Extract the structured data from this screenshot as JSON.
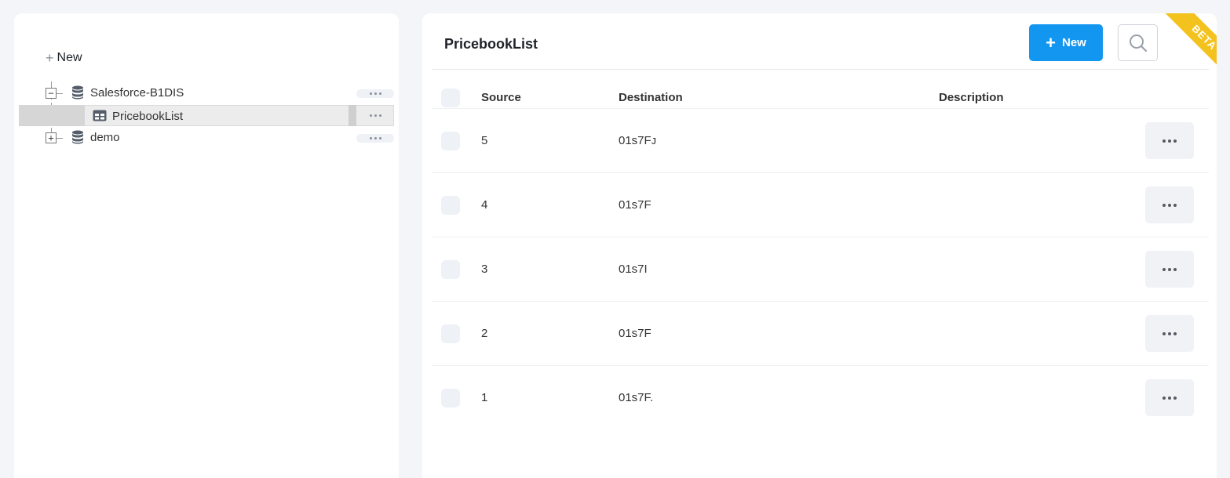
{
  "tree": {
    "new_label": "New",
    "items": [
      {
        "label": "Salesforce-B1DIS",
        "type": "database",
        "expander": "−"
      },
      {
        "label": "PricebookList",
        "type": "table"
      },
      {
        "label": "demo",
        "type": "database",
        "expander": "+"
      }
    ]
  },
  "main": {
    "title": "PricebookList",
    "new_button": "New",
    "beta_label": "BETA",
    "columns": {
      "source": "Source",
      "destination": "Destination",
      "description": "Description"
    },
    "rows": [
      {
        "source": "5",
        "destination": "01s7Fᴊ",
        "description": ""
      },
      {
        "source": "4",
        "destination": "01s7F",
        "description": ""
      },
      {
        "source": "3",
        "destination": "01s7I",
        "description": ""
      },
      {
        "source": "2",
        "destination": "01s7F",
        "description": ""
      },
      {
        "source": "1",
        "destination": "01s7F.",
        "description": ""
      }
    ]
  },
  "colors": {
    "accent": "#1296f0",
    "beta": "#f4c21c",
    "background": "#f3f5f9"
  },
  "icons": [
    "plus-icon",
    "database-icon",
    "table-icon",
    "more-icon",
    "search-icon"
  ]
}
